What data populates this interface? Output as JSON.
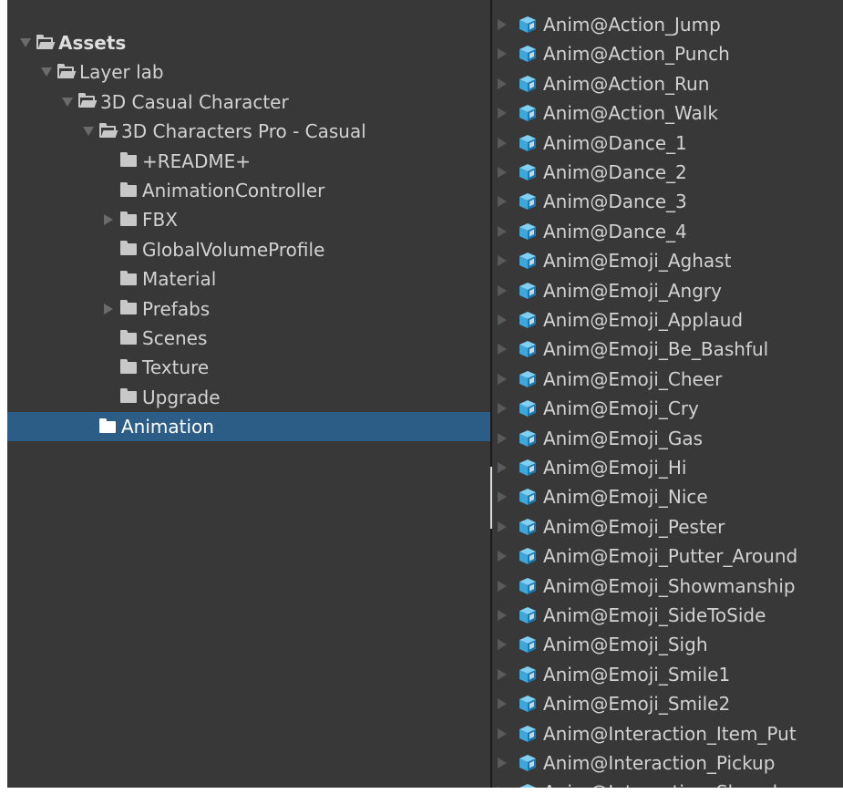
{
  "folder_tree": {
    "items": [
      {
        "label": "Assets",
        "depth": 0,
        "caret": "open",
        "icon": "folder-open-icon",
        "bold": true,
        "selected": false
      },
      {
        "label": "Layer lab",
        "depth": 1,
        "caret": "open",
        "icon": "folder-open-icon",
        "bold": false,
        "selected": false
      },
      {
        "label": "3D Casual Character",
        "depth": 2,
        "caret": "open",
        "icon": "folder-open-icon",
        "bold": false,
        "selected": false
      },
      {
        "label": "3D Characters Pro - Casual",
        "depth": 3,
        "caret": "open",
        "icon": "folder-open-icon",
        "bold": false,
        "selected": false
      },
      {
        "label": "+README+",
        "depth": 4,
        "caret": "none",
        "icon": "folder-icon",
        "bold": false,
        "selected": false
      },
      {
        "label": "AnimationController",
        "depth": 4,
        "caret": "none",
        "icon": "folder-icon",
        "bold": false,
        "selected": false
      },
      {
        "label": "FBX",
        "depth": 4,
        "caret": "closed",
        "icon": "folder-icon",
        "bold": false,
        "selected": false
      },
      {
        "label": "GlobalVolumeProfile",
        "depth": 4,
        "caret": "none",
        "icon": "folder-icon",
        "bold": false,
        "selected": false
      },
      {
        "label": "Material",
        "depth": 4,
        "caret": "none",
        "icon": "folder-icon",
        "bold": false,
        "selected": false
      },
      {
        "label": "Prefabs",
        "depth": 4,
        "caret": "closed",
        "icon": "folder-icon",
        "bold": false,
        "selected": false
      },
      {
        "label": "Scenes",
        "depth": 4,
        "caret": "none",
        "icon": "folder-icon",
        "bold": false,
        "selected": false
      },
      {
        "label": "Texture",
        "depth": 4,
        "caret": "none",
        "icon": "folder-icon",
        "bold": false,
        "selected": false
      },
      {
        "label": "Upgrade",
        "depth": 4,
        "caret": "none",
        "icon": "folder-icon",
        "bold": false,
        "selected": false
      },
      {
        "label": "Animation",
        "depth": 3,
        "caret": "none",
        "icon": "folder-icon",
        "bold": false,
        "selected": true
      }
    ]
  },
  "asset_list": {
    "icon": "model-prefab-cube-icon",
    "items": [
      "Anim@Action_Jump",
      "Anim@Action_Punch",
      "Anim@Action_Run",
      "Anim@Action_Walk",
      "Anim@Dance_1",
      "Anim@Dance_2",
      "Anim@Dance_3",
      "Anim@Dance_4",
      "Anim@Emoji_Aghast",
      "Anim@Emoji_Angry",
      "Anim@Emoji_Applaud",
      "Anim@Emoji_Be_Bashful",
      "Anim@Emoji_Cheer",
      "Anim@Emoji_Cry",
      "Anim@Emoji_Gas",
      "Anim@Emoji_Hi",
      "Anim@Emoji_Nice",
      "Anim@Emoji_Pester",
      "Anim@Emoji_Putter_Around",
      "Anim@Emoji_Showmanship",
      "Anim@Emoji_SideToSide",
      "Anim@Emoji_Sigh",
      "Anim@Emoji_Smile1",
      "Anim@Emoji_Smile2",
      "Anim@Interaction_Item_Put",
      "Anim@Interaction_Pickup",
      "Anim@Interaction_Shovel"
    ]
  },
  "colors": {
    "panel_bg": "#383838",
    "selection": "#2c5d87",
    "text": "#d2d2d2",
    "cube_light": "#7fd0f2",
    "cube_mid": "#3ea6d8",
    "cube_dark": "#1d78b0"
  }
}
